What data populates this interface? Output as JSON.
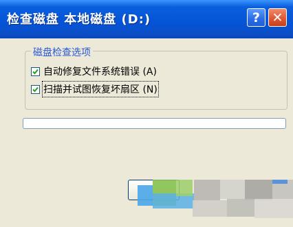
{
  "window": {
    "title": "检查磁盘 本地磁盘 (D:)",
    "help_glyph": "?",
    "close_glyph": "✕"
  },
  "options_group": {
    "legend": "磁盘检查选项",
    "options": [
      {
        "label": "自动修复文件系统错误 (A)",
        "checked": true
      },
      {
        "label": "扫描并试图恢复坏扇区 (N)",
        "checked": true
      }
    ]
  },
  "progress": {
    "value": 0
  },
  "colors": {
    "title_bar": "#0553d7",
    "legend_text": "#2a57d6",
    "check_mark": "#21a121",
    "close_button": "#e05a34"
  }
}
